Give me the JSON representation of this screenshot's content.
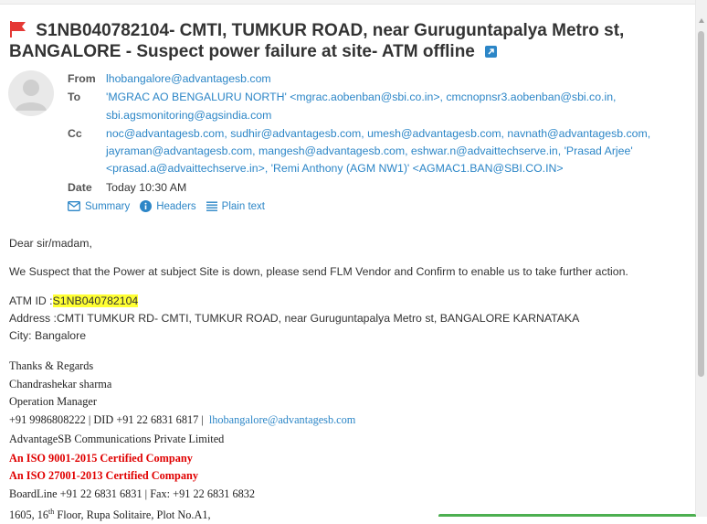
{
  "subject": {
    "text": "S1NB040782104- CMTI, TUMKUR ROAD, near Guruguntapalya Metro st, BANGALORE - Suspect power failure at site- ATM offline",
    "flag_color": "#e53935",
    "icon": "external-link-icon"
  },
  "headers": {
    "from_label": "From",
    "from": "lhobangalore@advantagesb.com",
    "to_label": "To",
    "to_line1": "'MGRAC AO BENGALURU NORTH' <mgrac.aobenban@sbi.co.in>, cmcnopnsr3.aobenban@sbi.co.in,",
    "to_line2": "sbi.agsmonitoring@agsindia.com",
    "cc_label": "Cc",
    "cc_line1": "noc@advantagesb.com, sudhir@advantagesb.com, umesh@advantagesb.com, navnath@advantagesb.com,",
    "cc_line2": "jayraman@advantagesb.com, mangesh@advantagesb.com, eshwar.n@advaittechserve.in, 'Prasad Arjee'",
    "cc_line3": "<prasad.a@advaittechserve.in>, 'Remi Anthony (AGM NW1)' <AGMAC1.BAN@SBI.CO.IN>",
    "date_label": "Date",
    "date": "Today 10:30 AM"
  },
  "tabs": {
    "summary": "Summary",
    "headers": "Headers",
    "plain_text": "Plain text"
  },
  "body": {
    "greeting": "Dear sir/madam,",
    "message": "We Suspect that the Power at subject Site is down, please send FLM Vendor and Confirm to enable us to take further action.",
    "atm_label": "ATM ID :",
    "atm_id": "S1NB040782104",
    "address": "Address :CMTI TUMKUR RD- CMTI, TUMKUR ROAD, near Guruguntapalya Metro st, BANGALORE KARNATAKA",
    "city": "City: Bangalore"
  },
  "signature": {
    "thanks": "Thanks & Regards",
    "name": "Chandrashekar sharma",
    "title": "Operation Manager",
    "phone": "+91 9986808222 | DID +91 22 6831 6817 |",
    "email": "lhobangalore@advantagesb.com",
    "company": "AdvantageSB Communications Private Limited",
    "iso1": "An ISO 9001-2015 Certified Company",
    "iso2": "An ISO 27001-2013 Certified Company",
    "boardline": "BoardLine +91 22 6831 6831 | Fax: +91 22 6831 6832",
    "addr_pre": "1605, 16",
    "addr_sup": "th",
    "addr_post": " Floor, Rupa Solitaire, Plot No.A1,"
  },
  "colors": {
    "link": "#2c86c7",
    "highlight": "#ffff33",
    "iso_red": "#e00000"
  }
}
